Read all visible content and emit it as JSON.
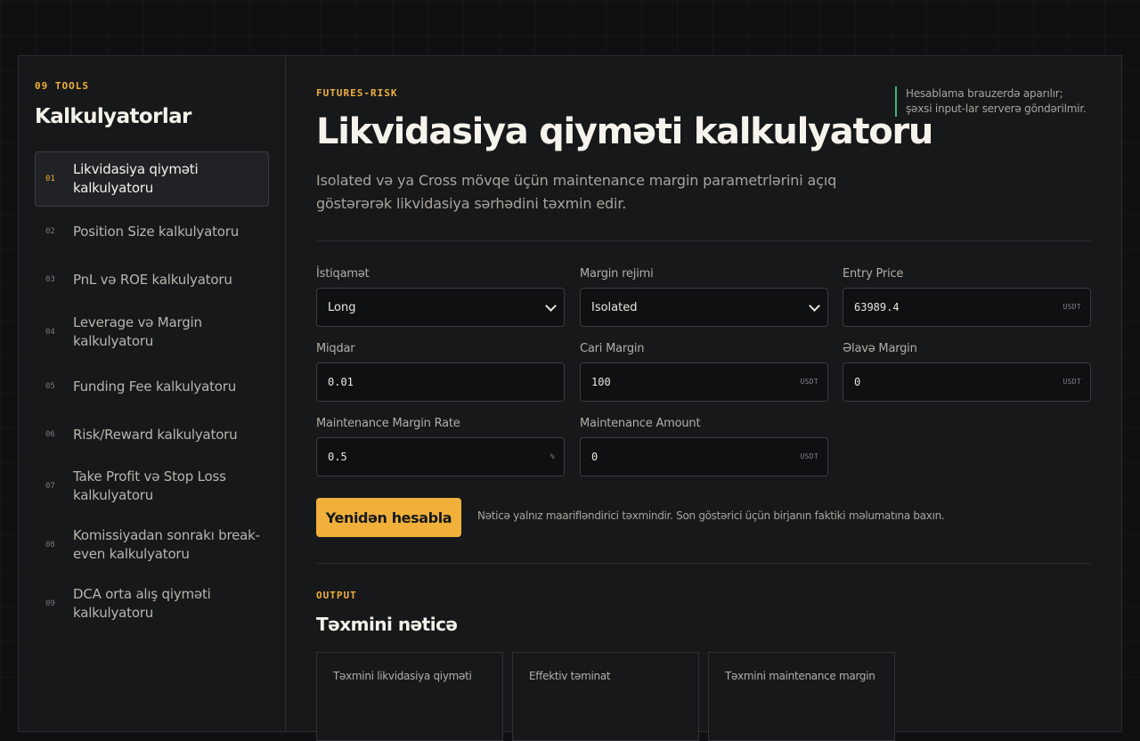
{
  "sidebar": {
    "kicker": "09 TOOLS",
    "title": "Kalkulyatorlar",
    "items": [
      {
        "num": "01",
        "label": "Likvidasiya qiymәti kalkulyatoru"
      },
      {
        "num": "02",
        "label": "Position Size kalkulyatoru"
      },
      {
        "num": "03",
        "label": "PnL vә ROE kalkulyatoru"
      },
      {
        "num": "04",
        "label": "Leverage vә Margin kalkulyatoru"
      },
      {
        "num": "05",
        "label": "Funding Fee kalkulyatoru"
      },
      {
        "num": "06",
        "label": "Risk/Reward kalkulyatoru"
      },
      {
        "num": "07",
        "label": "Take Profit vә Stop Loss kalkulyatoru"
      },
      {
        "num": "08",
        "label": "Komissiyadan sonrakı break-even kalkulyatoru"
      },
      {
        "num": "09",
        "label": "DCA orta alış qiymәti kalkulyatoru"
      }
    ]
  },
  "header": {
    "kicker": "FUTURES-RISK",
    "title": "Likvidasiya qiymәti kalkulyatoru",
    "subtitle": "Isolated vә ya Cross mövqe üçün maintenance margin parametrlәrini açıq göstәrәrәk likvidasiya sәrhәdini tәxmin edir.",
    "privacy_note": "Hesablama brauzerdә aparılır; şәxsi input-lar serverә göndәrilmir."
  },
  "form": {
    "direction": {
      "label": "İstiqamәt",
      "value": "Long"
    },
    "margin_mode": {
      "label": "Margin rejimi",
      "value": "Isolated"
    },
    "entry_price": {
      "label": "Entry Price",
      "value": "63989.4",
      "unit": "USDT"
    },
    "quantity": {
      "label": "Miqdar",
      "value": "0.01"
    },
    "current_margin": {
      "label": "Cari Margin",
      "value": "100",
      "unit": "USDT"
    },
    "additional_margin": {
      "label": "Әlavә Margin",
      "value": "0",
      "unit": "USDT"
    },
    "mm_rate": {
      "label": "Maintenance Margin Rate",
      "value": "0.5",
      "unit": "%"
    },
    "mm_amount": {
      "label": "Maintenance Amount",
      "value": "0",
      "unit": "USDT"
    },
    "recalc_label": "Yenidәn hesabla",
    "disclaimer": "Nәticә yalnız maariflәndirici tәxmindir. Son göstәrici üçün birjanın faktiki mәlumatına baxın."
  },
  "output": {
    "kicker": "OUTPUT",
    "title": "Tәxmini nәticә",
    "cards": [
      {
        "label": "Tәxmini likvidasiya qiymәti"
      },
      {
        "label": "Effektiv tәminat"
      },
      {
        "label": "Tәxmini maintenance margin"
      }
    ]
  }
}
